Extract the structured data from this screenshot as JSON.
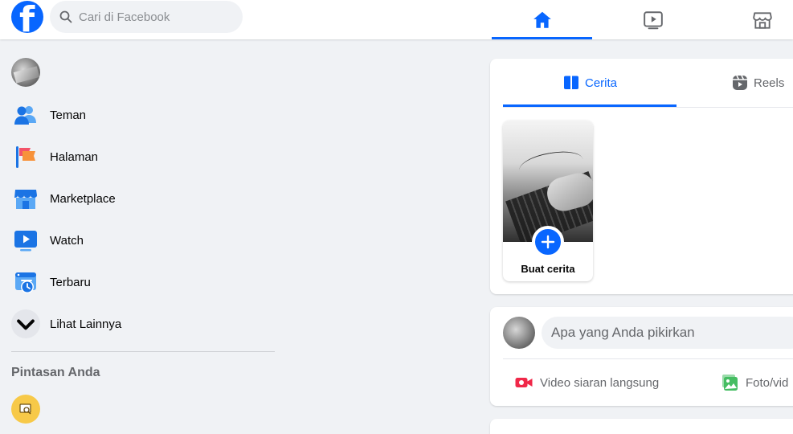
{
  "topbar": {
    "logo_icon": "facebook-logo",
    "logo_letter": "f",
    "search_placeholder": "Cari di Facebook",
    "nav": [
      {
        "icon": "home-icon",
        "active": true
      },
      {
        "icon": "video-icon",
        "active": false
      },
      {
        "icon": "marketplace-icon",
        "active": false
      }
    ]
  },
  "sidebar": {
    "items": [
      {
        "label": "Teman",
        "icon": "friends-icon"
      },
      {
        "label": "Halaman",
        "icon": "pages-flag-icon"
      },
      {
        "label": "Marketplace",
        "icon": "marketplace-icon"
      },
      {
        "label": "Watch",
        "icon": "watch-icon"
      },
      {
        "label": "Terbaru",
        "icon": "recent-icon"
      },
      {
        "label": "Lihat Lainnya",
        "icon": "chevron-down-icon"
      }
    ],
    "shortcuts_title": "Pintasan Anda"
  },
  "stories": {
    "tabs": [
      {
        "label": "Cerita",
        "icon": "book-icon",
        "active": true
      },
      {
        "label": "Reels",
        "icon": "reels-icon",
        "active": false
      }
    ],
    "create_label": "Buat cerita"
  },
  "composer": {
    "placeholder": "Apa yang Anda pikirkan",
    "actions": [
      {
        "label": "Video siaran langsung",
        "icon": "live-video-icon"
      },
      {
        "label": "Foto/vid",
        "icon": "photo-icon"
      }
    ]
  },
  "colors": {
    "brand": "#0866ff",
    "background": "#f0f2f5",
    "live_red": "#f02849",
    "photo_green": "#45bd62"
  }
}
